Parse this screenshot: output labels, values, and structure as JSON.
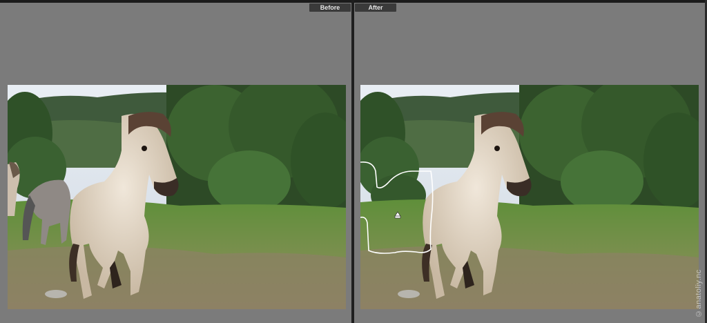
{
  "labels": {
    "before": "Before",
    "after": "After"
  },
  "watermark": "©anatoliy.nc",
  "colors": {
    "background": "#7b7b7b",
    "label_bg": "#3a3a3a",
    "label_text": "#e6e6e6"
  }
}
